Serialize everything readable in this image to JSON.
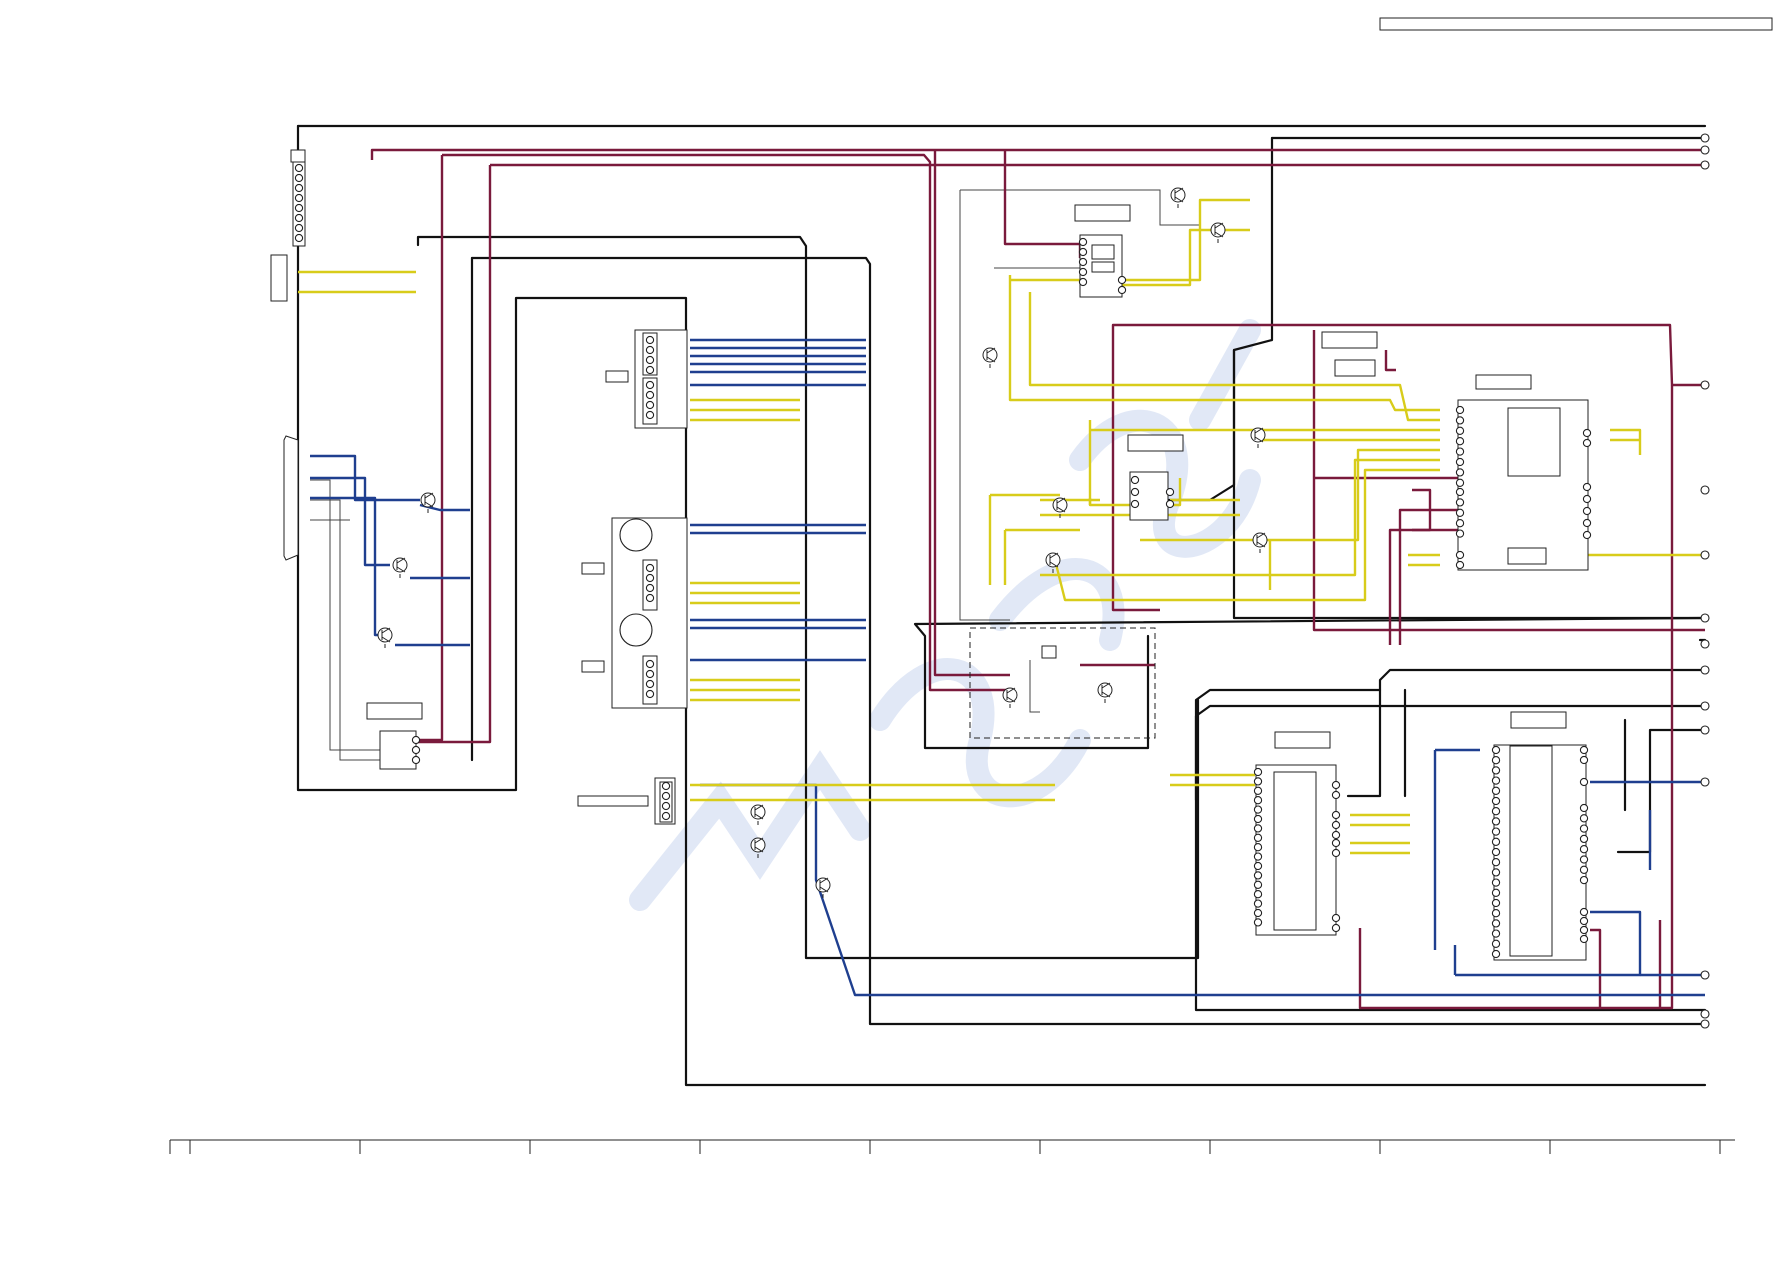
{
  "colors": {
    "background": "#ffffff",
    "wire_black": "#111111",
    "wire_thin": "#444444",
    "wire_red": "#7a1a3c",
    "wire_blue": "#1f3f8f",
    "wire_yellow": "#d8cc1a",
    "watermark": "#c9d6ef"
  },
  "header": {
    "title_box": ""
  },
  "footer": {
    "zones": [
      "",
      "",
      "",
      "",
      "",
      "",
      "",
      "",
      ""
    ]
  },
  "labels": {
    "ic_top_center": "",
    "ic_left_buffer": "",
    "ic_mid_amp": "",
    "ic_right_top": "",
    "ic_right_mid": "",
    "ic_bottom_a": "",
    "ic_bottom_b": "",
    "jack_group_1": "",
    "jack_group_2": "",
    "jack_group_3": "",
    "connector_bottom": ""
  }
}
